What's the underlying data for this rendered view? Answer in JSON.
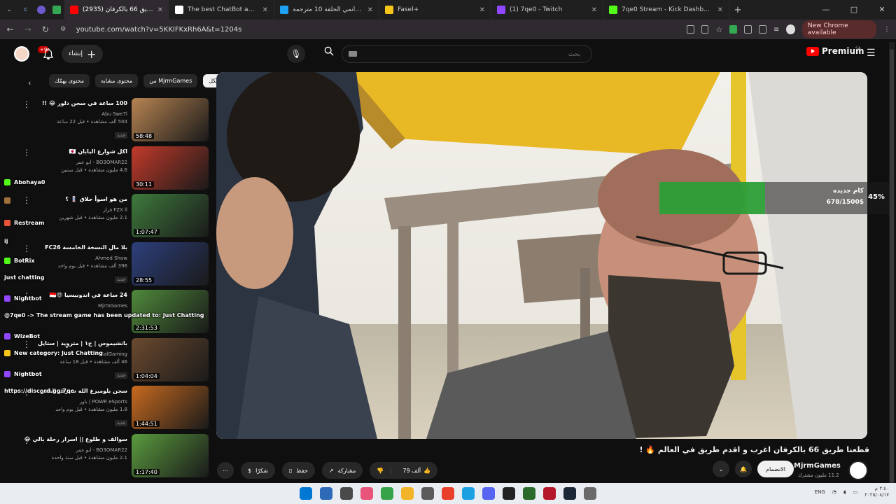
{
  "browser": {
    "tabs": [
      {
        "title": "قطعنا طريق 66 بالكرفان (2935)",
        "favicon_color": "#ff0000",
        "active": true
      },
      {
        "title": "The best ChatBot and Widgets",
        "favicon_color": "#ffffff",
        "active": false
      },
      {
        "title": "انمي الحلقة 10 مترجمة Kingdom",
        "favicon_color": "#1da1f2",
        "active": false
      },
      {
        "title": "Fasel+",
        "favicon_color": "#f5c518",
        "active": false
      },
      {
        "title": "(1) 7qe0 - Twitch",
        "favicon_color": "#9146ff",
        "active": false
      },
      {
        "title": "7qe0 Stream - Kick Dashboard",
        "favicon_color": "#53fc18",
        "active": false
      }
    ],
    "new_tab": "+",
    "url": "youtube.com/watch?v=5KKIFKxRh6A&t=1204s",
    "new_chrome_label": "New Chrome available",
    "window_controls": {
      "minimize": "—",
      "maximize": "□",
      "close": "✕"
    }
  },
  "youtube": {
    "header": {
      "create_label": "إنشاء",
      "notification_count": "+9",
      "search_placeholder": "بحث",
      "premium_label": "Premium",
      "region": "SA"
    },
    "chips": [
      "الكل",
      "من MjrmGames",
      "محتوى مشابه",
      "محتوى يهمّك"
    ],
    "related": [
      {
        "title": "100 ساعة في سجن دلور 😂 !!",
        "channel": "Abu Swe7l",
        "meta": "504 ألف مشاهدة • قبل 22 ساعة",
        "duration": "58:48",
        "new": "جديد",
        "thumb": "#b78452"
      },
      {
        "title": "اكل شوارع اليابان 🇯🇵",
        "channel": "BO3OMAR22 - ابو عمر",
        "meta": "4.6 مليون مشاهدة • قبل سنتين",
        "duration": "30:11",
        "new": "",
        "thumb": "#c23a2a"
      },
      {
        "title": "من هو اسوأ حلاق 💈 ؟",
        "channel": "FZX ll فزاز",
        "meta": "2.1 مليون مشاهدة • قبل شهرين",
        "duration": "1:07:47",
        "new": "",
        "thumb": "#3e7a3c"
      },
      {
        "title": "بلا مال النسخة الخامسة FC26",
        "channel": "Ahmed Show",
        "meta": "396 ألف مشاهدة • قبل يوم واحد",
        "duration": "28:55",
        "new": "جديد",
        "thumb": "#2d3f7d"
      },
      {
        "title": "24 ساعة في اندونيسيا 😍🇮🇩",
        "channel": "MjrmGames",
        "meta": "",
        "duration": "2:31:53",
        "new": "",
        "thumb": "#4f8a3b"
      },
      {
        "title": "باتشيموس | ج١ | متروید | ستايل بكسل واصعة مجلد جداً",
        "channel": "SalGaming",
        "meta": "46 ألف مشاهدة • قبل 18 ساعة",
        "duration": "1:04:04",
        "new": "جديد",
        "thumb": "#6b4a2f"
      },
      {
        "title": "سجن بلومبرغ الله سيرفر الناس",
        "channel": "POWR eSports | باور",
        "meta": "1.8 مليون مشاهدة • قبل يوم واحد",
        "duration": "1:44:51",
        "new": "جديد",
        "thumb": "#c76a1f"
      },
      {
        "title": "سوالف و طلوع || اسرار رحلة بالي 😂 ID",
        "channel": "BO3OMAR22 - ابو عمر",
        "meta": "2.1 مليون مشاهدة • قبل سنة واحدة",
        "duration": "1:17:40",
        "new": "",
        "thumb": "#5a9b3e"
      }
    ],
    "chat": [
      {
        "text": "Abohaya0",
        "color": "#53fc18"
      },
      {
        "text": "",
        "color": "#a0703a"
      },
      {
        "text": "Restream",
        "color": "#e8543a"
      },
      {
        "text": "ij",
        "color": ""
      },
      {
        "text": "BotRix",
        "color": "#53fc18"
      },
      {
        "text": "just chatting",
        "color": ""
      },
      {
        "text": "Nightbot",
        "color": "#9146ff"
      },
      {
        "text": "@7qe0 -> The stream game has been updated to: Just Chatting",
        "color": ""
      },
      {
        "text": "WizeBot",
        "color": "#9146ff"
      },
      {
        "text": "New category: Just Chatting",
        "color": "#f5c518"
      },
      {
        "text": "Nightbot",
        "color": "#9146ff"
      },
      {
        "text": "https://discord.gg/7qe",
        "color": ""
      }
    ],
    "goal": {
      "title": "كام جديده",
      "amount": "678/1500$",
      "percent": "45%",
      "progress": 0.45
    },
    "video": {
      "title": "قطعنا طريق 66 بالكرفان اغرب و اقدم طريق في العالم 🔥 !",
      "channel": "MjrmGames",
      "subscribers": "11.2 مليون مشترك",
      "join_label": "الانضمام",
      "likes": "79 ألف",
      "share_label": "مشاركة",
      "save_label": "حفظ",
      "thanks_label": "شكرًا"
    }
  },
  "taskbar": {
    "apps": [
      "#0078d4",
      "#2d6ab7",
      "#4a4a4a",
      "#e8547a",
      "#37a349",
      "#f2b428",
      "#5b5b5b",
      "#e8402b",
      "#1ba1e2",
      "#5865f2",
      "#222222",
      "#2a6a2a",
      "#b5162a",
      "#1b2838",
      "#6a6a6a"
    ],
    "lang": "ENG",
    "time": "٢:٤٠ م",
    "date": "٢٠٢٥/٠٨/١٧"
  }
}
